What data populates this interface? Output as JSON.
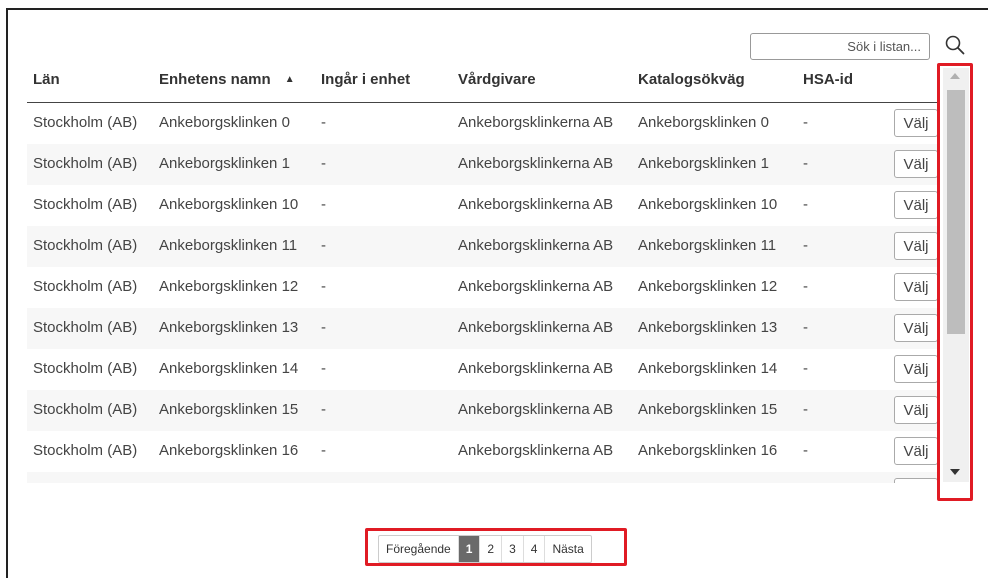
{
  "search": {
    "placeholder": "Sök i listan..."
  },
  "table": {
    "columns": [
      "Län",
      "Enhetens namn",
      "Ingår i enhet",
      "Vårdgivare",
      "Katalogsökväg",
      "HSA-id"
    ],
    "sort_indicator": "▲",
    "rows": [
      {
        "lan": "Stockholm (AB)",
        "name": "Ankeborgsklinken 0",
        "ingar": "-",
        "vardgivare": "Ankeborgsklinkerna AB",
        "katalog": "Ankeborgsklinken 0",
        "hsa": "-",
        "button": "Välj"
      },
      {
        "lan": "Stockholm (AB)",
        "name": "Ankeborgsklinken 1",
        "ingar": "-",
        "vardgivare": "Ankeborgsklinkerna AB",
        "katalog": "Ankeborgsklinken 1",
        "hsa": "-",
        "button": "Välj"
      },
      {
        "lan": "Stockholm (AB)",
        "name": "Ankeborgsklinken 10",
        "ingar": "-",
        "vardgivare": "Ankeborgsklinkerna AB",
        "katalog": "Ankeborgsklinken 10",
        "hsa": "-",
        "button": "Välj"
      },
      {
        "lan": "Stockholm (AB)",
        "name": "Ankeborgsklinken 11",
        "ingar": "-",
        "vardgivare": "Ankeborgsklinkerna AB",
        "katalog": "Ankeborgsklinken 11",
        "hsa": "-",
        "button": "Välj"
      },
      {
        "lan": "Stockholm (AB)",
        "name": "Ankeborgsklinken 12",
        "ingar": "-",
        "vardgivare": "Ankeborgsklinkerna AB",
        "katalog": "Ankeborgsklinken 12",
        "hsa": "-",
        "button": "Välj"
      },
      {
        "lan": "Stockholm (AB)",
        "name": "Ankeborgsklinken 13",
        "ingar": "-",
        "vardgivare": "Ankeborgsklinkerna AB",
        "katalog": "Ankeborgsklinken 13",
        "hsa": "-",
        "button": "Välj"
      },
      {
        "lan": "Stockholm (AB)",
        "name": "Ankeborgsklinken 14",
        "ingar": "-",
        "vardgivare": "Ankeborgsklinkerna AB",
        "katalog": "Ankeborgsklinken 14",
        "hsa": "-",
        "button": "Välj"
      },
      {
        "lan": "Stockholm (AB)",
        "name": "Ankeborgsklinken 15",
        "ingar": "-",
        "vardgivare": "Ankeborgsklinkerna AB",
        "katalog": "Ankeborgsklinken 15",
        "hsa": "-",
        "button": "Välj"
      },
      {
        "lan": "Stockholm (AB)",
        "name": "Ankeborgsklinken 16",
        "ingar": "-",
        "vardgivare": "Ankeborgsklinkerna AB",
        "katalog": "Ankeborgsklinken 16",
        "hsa": "-",
        "button": "Välj"
      }
    ]
  },
  "pagination": {
    "previous": "Föregående",
    "pages": [
      "1",
      "2",
      "3",
      "4"
    ],
    "active_page": "1",
    "next": "Nästa"
  },
  "colors": {
    "highlight": "#e01b24",
    "active_page": "#6a6a6a"
  }
}
